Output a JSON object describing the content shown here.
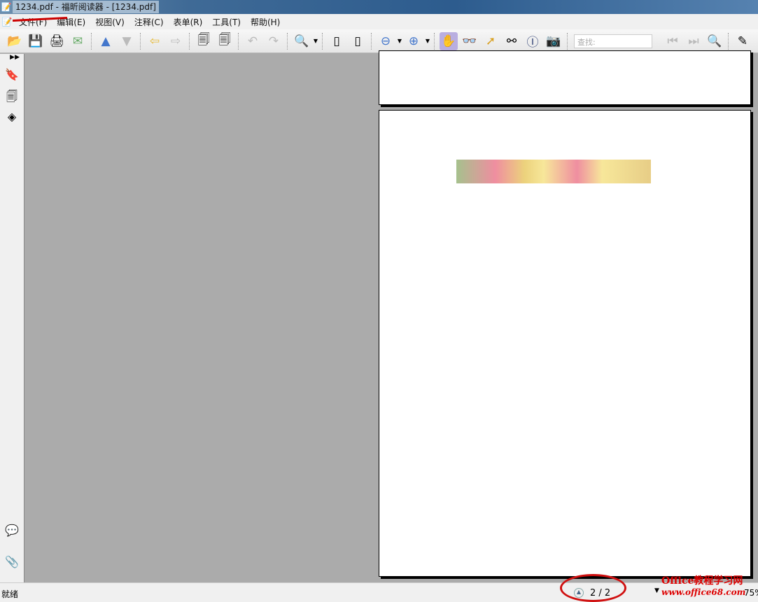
{
  "title": "1234.pdf - 福昕阅读器 - [1234.pdf]",
  "menu": [
    "文件(F)",
    "编辑(E)",
    "视图(V)",
    "注释(C)",
    "表单(R)",
    "工具(T)",
    "帮助(H)"
  ],
  "toolbar": {
    "search_placeholder": "查找:"
  },
  "status": {
    "ready": "就绪",
    "page_indicator": "2 / 2",
    "zoom": "75%"
  },
  "watermark": {
    "line1": "Office教程学习网",
    "line2": "www.office68.com"
  },
  "accent_annotation_color": "#d01010"
}
